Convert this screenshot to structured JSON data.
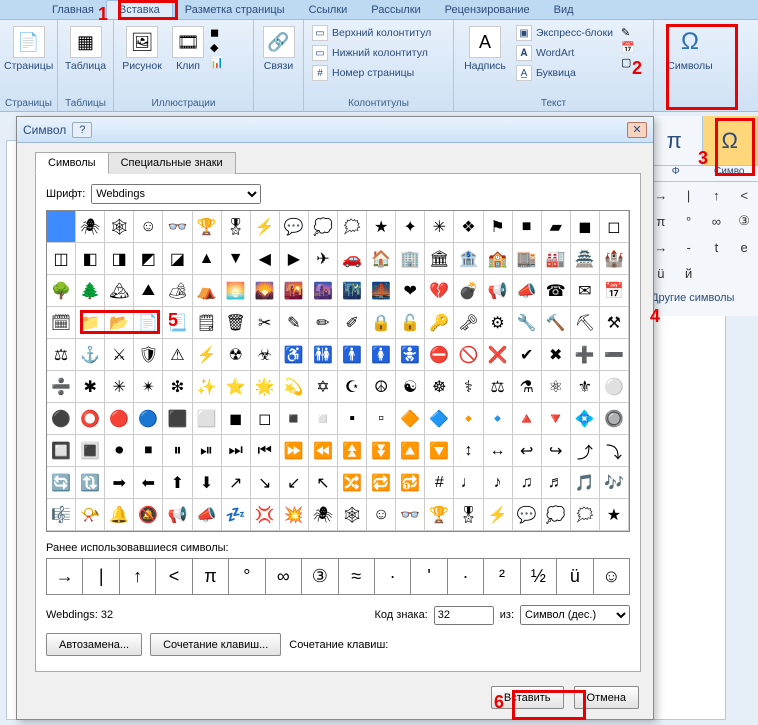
{
  "ribbon": {
    "tabs": [
      "Главная",
      "Вставка",
      "Разметка страницы",
      "Ссылки",
      "Рассылки",
      "Рецензирование",
      "Вид"
    ],
    "active_tab": "Вставка",
    "groups": {
      "pages": {
        "label": "Страницы",
        "btn": "Страницы"
      },
      "tables": {
        "label": "Таблицы",
        "btn": "Таблица"
      },
      "illus": {
        "label": "Иллюстрации",
        "b1": "Рисунок",
        "b2": "Клип"
      },
      "links": {
        "label": "",
        "btn": "Связи"
      },
      "header": {
        "label": "Колонтитулы",
        "i1": "Верхний колонтитул",
        "i2": "Нижний колонтитул",
        "i3": "Номер страницы"
      },
      "textgrp": {
        "label": "Текст",
        "btn": "Надпись",
        "i1": "Экспресс-блоки",
        "i2": "WordArt",
        "i3": "Буквица"
      },
      "sym": {
        "label": "",
        "btn": "Символы"
      }
    }
  },
  "mini": {
    "pi": "π",
    "omega": "Ω",
    "phi": "Φ",
    "grid": [
      "→",
      "|",
      "↑",
      "<",
      "π",
      "°",
      "∞",
      "③",
      "→",
      "-",
      "t",
      "е",
      "ü",
      "й",
      "",
      ""
    ],
    "more": "Другие символы",
    "mini_sym": "Симво"
  },
  "dialog": {
    "title": "Символ",
    "tab1": "Символы",
    "tab2": "Специальные знаки",
    "font_label": "Шрифт:",
    "font_value": "Webdings",
    "recent_label": "Ранее использовавшиеся символы:",
    "recent": [
      "→",
      "|",
      "↑",
      "<",
      "π",
      "°",
      "∞",
      "③",
      "≈",
      "·",
      "'",
      "·",
      "²",
      "½",
      "ü",
      "☺"
    ],
    "charname": "Webdings: 32",
    "code_label": "Код знака:",
    "code_value": "32",
    "from_label": "из:",
    "from_value": "Символ (дес.)",
    "auto_btn": "Автозамена...",
    "shortcut_btn": "Сочетание клавиш...",
    "shortcut_lbl": "Сочетание клавиш:",
    "insert_btn": "Вставить",
    "cancel_btn": "Отмена"
  },
  "marks": {
    "m1": "1",
    "m2": "2",
    "m3": "3",
    "m4": "4",
    "m5": "5",
    "m6": "6"
  }
}
